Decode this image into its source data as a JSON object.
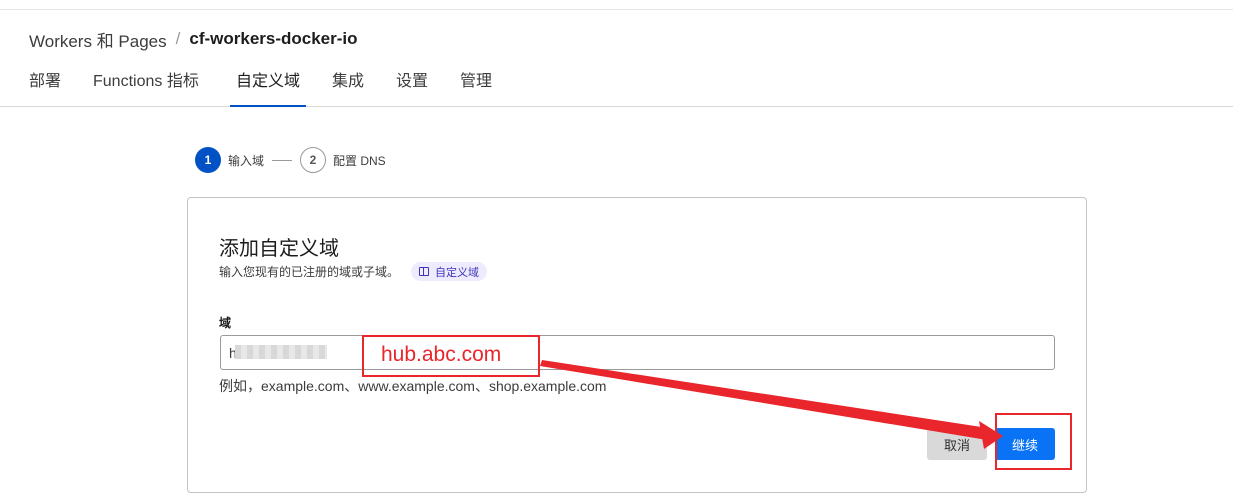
{
  "breadcrumb": {
    "parent": "Workers 和 Pages",
    "separator": "/",
    "current": "cf-workers-docker-io"
  },
  "tabs": [
    {
      "label": "部署"
    },
    {
      "label": "Functions 指标"
    },
    {
      "label": "自定义域",
      "active": true
    },
    {
      "label": "集成"
    },
    {
      "label": "设置"
    },
    {
      "label": "管理"
    }
  ],
  "stepper": {
    "steps": [
      {
        "number": "1",
        "label": "输入域",
        "state": "active"
      },
      {
        "number": "2",
        "label": "配置 DNS",
        "state": "pending"
      }
    ]
  },
  "card": {
    "title": "添加自定义域",
    "description": "输入您现有的已注册的域或子域。",
    "doc_link": "自定义域",
    "field_label": "域",
    "input_value": "h",
    "helper": "例如，example.com、www.example.com、shop.example.com",
    "cancel_label": "取消",
    "continue_label": "继续"
  },
  "annotation": {
    "text": "hub.abc.com",
    "color": "#e8262c"
  },
  "colors": {
    "accent": "#0051c3",
    "primary_button": "#0a73f5",
    "annotation": "#e8262c"
  }
}
